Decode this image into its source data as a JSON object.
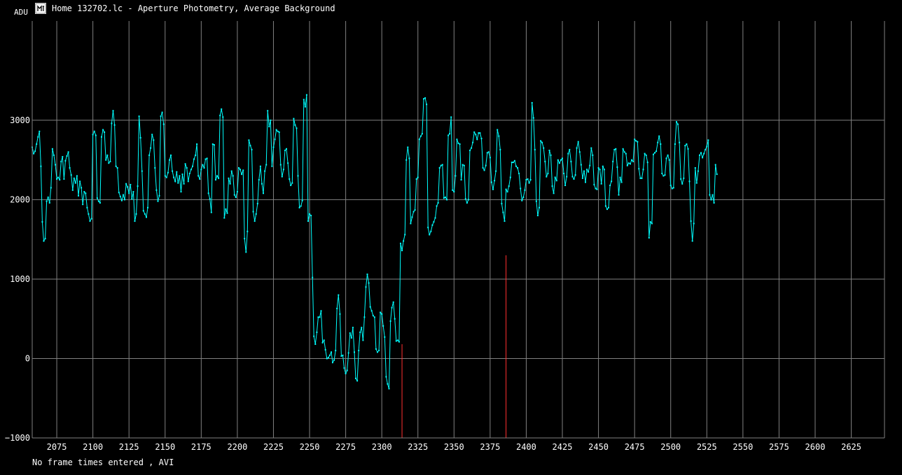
{
  "window": {
    "title": "Home 132702.lc - Aperture Photometry, Average Background",
    "icon": "mta-logo-icon"
  },
  "status": {
    "text": "No frame times entered , AVI"
  },
  "colors": {
    "background": "#000000",
    "grid": "#808080",
    "series": "#00ffff",
    "marker": "#ff3030",
    "text": "#ffffff"
  },
  "chart_data": {
    "type": "line",
    "title": "",
    "xlabel": "",
    "ylabel": "ADU",
    "xlim": [
      2058,
      2648
    ],
    "ylim": [
      -1000,
      4250
    ],
    "x_ticks": [
      2075,
      2100,
      2125,
      2150,
      2175,
      2200,
      2225,
      2250,
      2275,
      2300,
      2325,
      2350,
      2375,
      2400,
      2425,
      2450,
      2475,
      2500,
      2525,
      2550,
      2575,
      2600,
      2625
    ],
    "y_ticks": [
      -1000,
      0,
      1000,
      2000,
      3000
    ],
    "y_tick_labels": [
      "−1000",
      "0",
      "1000",
      "2000",
      "3000"
    ],
    "grid": true,
    "markers": [
      {
        "x": 2314,
        "y": 180
      },
      {
        "x": 2386,
        "y": 1300
      }
    ],
    "series": [
      {
        "x_start": 2058,
        "x_step": 1,
        "values": [
          2660,
          2580,
          2610,
          2700,
          2790,
          2860,
          2420,
          1720,
          1480,
          1510,
          1980,
          2030,
          1960,
          2150,
          2640,
          2560,
          2440,
          2260,
          2280,
          2250,
          2480,
          2540,
          2260,
          2490,
          2550,
          2600,
          2400,
          2310,
          2120,
          2270,
          2210,
          2300,
          2050,
          2230,
          2150,
          1940,
          2100,
          2080,
          1900,
          1820,
          1730,
          1760,
          2820,
          2860,
          2810,
          2020,
          1980,
          1960,
          2790,
          2880,
          2850,
          2500,
          2560,
          2460,
          2480,
          2960,
          3120,
          2940,
          2420,
          2400,
          2090,
          2040,
          1990,
          2060,
          2000,
          2200,
          2160,
          2080,
          2190,
          2010,
          2100,
          1730,
          1820,
          2170,
          3050,
          2780,
          2360,
          1860,
          1820,
          1780,
          1900,
          2560,
          2650,
          2820,
          2750,
          2400,
          2120,
          1980,
          2050,
          3050,
          3100,
          2950,
          2300,
          2280,
          2340,
          2500,
          2560,
          2360,
          2280,
          2230,
          2350,
          2210,
          2300,
          2100,
          2320,
          2200,
          2450,
          2400,
          2230,
          2330,
          2380,
          2420,
          2510,
          2560,
          2700,
          2300,
          2260,
          2380,
          2440,
          2400,
          2510,
          2520,
          2080,
          2010,
          1840,
          2700,
          2690,
          2250,
          2300,
          2270,
          3060,
          3140,
          3040,
          1770,
          1880,
          1830,
          2270,
          2200,
          2360,
          2300,
          2060,
          2030,
          2100,
          2400,
          2380,
          2320,
          2370,
          1510,
          1340,
          1600,
          2750,
          2680,
          2630,
          1850,
          1730,
          1820,
          1950,
          2250,
          2420,
          2200,
          2080,
          2360,
          2440,
          3120,
          2920,
          3000,
          2420,
          2660,
          2760,
          2880,
          2860,
          2850,
          2440,
          2290,
          2380,
          2620,
          2640,
          2460,
          2260,
          2180,
          2210,
          3020,
          2940,
          2900,
          2300,
          1900,
          1920,
          1990,
          3260,
          3170,
          3320,
          1730,
          1820,
          1800,
          1020,
          280,
          180,
          330,
          520,
          520,
          600,
          200,
          230,
          110,
          0,
          10,
          40,
          80,
          -50,
          -20,
          100,
          630,
          800,
          560,
          30,
          40,
          -120,
          -190,
          -150,
          70,
          320,
          260,
          390,
          80,
          -250,
          -280,
          100,
          330,
          390,
          230,
          520,
          900,
          1060,
          950,
          650,
          600,
          540,
          520,
          120,
          80,
          100,
          580,
          560,
          410,
          270,
          -230,
          -320,
          -380,
          470,
          640,
          710,
          500,
          220,
          230,
          210,
          1450,
          1360,
          1480,
          1560,
          2500,
          2660,
          2520,
          1700,
          1780,
          1850,
          1870,
          2260,
          2280,
          2760,
          2800,
          2830,
          3270,
          3280,
          3200,
          1650,
          1560,
          1600,
          1680,
          1720,
          1770,
          1920,
          1960,
          2400,
          2430,
          2440,
          2020,
          2030,
          2000,
          2810,
          2830,
          3040,
          2120,
          2100,
          2300,
          2760,
          2710,
          2700,
          2250,
          2440,
          2430,
          2010,
          1960,
          2000,
          2620,
          2650,
          2720,
          2850,
          2820,
          2760,
          2840,
          2840,
          2770,
          2400,
          2370,
          2430,
          2590,
          2600,
          2530,
          2220,
          2130,
          2240,
          2360,
          2880,
          2800,
          2630,
          1950,
          1840,
          1730,
          2130,
          2100,
          2170,
          2280,
          2470,
          2470,
          2490,
          2420,
          2400,
          2330,
          2140,
          1990,
          2030,
          2120,
          2250,
          2260,
          2210,
          2250,
          3220,
          3030,
          2630,
          1980,
          1800,
          1900,
          2740,
          2720,
          2650,
          2480,
          2290,
          2330,
          2620,
          2560,
          2170,
          2080,
          2280,
          2240,
          2500,
          2460,
          2500,
          2520,
          2330,
          2180,
          2290,
          2580,
          2630,
          2480,
          2290,
          2260,
          2310,
          2650,
          2730,
          2600,
          2440,
          2270,
          2360,
          2220,
          2380,
          2350,
          2430,
          2650,
          2560,
          2190,
          2140,
          2130,
          2400,
          2380,
          2200,
          2420,
          2380,
          1920,
          1880,
          1900,
          2180,
          2230,
          2480,
          2630,
          2640,
          2410,
          2060,
          2280,
          2220,
          2640,
          2600,
          2580,
          2430,
          2460,
          2450,
          2500,
          2480,
          2760,
          2740,
          2730,
          2390,
          2270,
          2270,
          2380,
          2580,
          2560,
          2470,
          1520,
          1720,
          1700,
          2570,
          2590,
          2610,
          2720,
          2800,
          2700,
          2330,
          2300,
          2310,
          2520,
          2560,
          2500,
          2180,
          2140,
          2150,
          2700,
          2980,
          2950,
          2720,
          2260,
          2200,
          2270,
          2680,
          2700,
          2640,
          2230,
          1730,
          1480,
          1700,
          2400,
          2210,
          2360,
          2560,
          2590,
          2530,
          2580,
          2630,
          2670,
          2750,
          2060,
          2000,
          2060,
          1960,
          2440,
          2320
        ]
      }
    ]
  }
}
